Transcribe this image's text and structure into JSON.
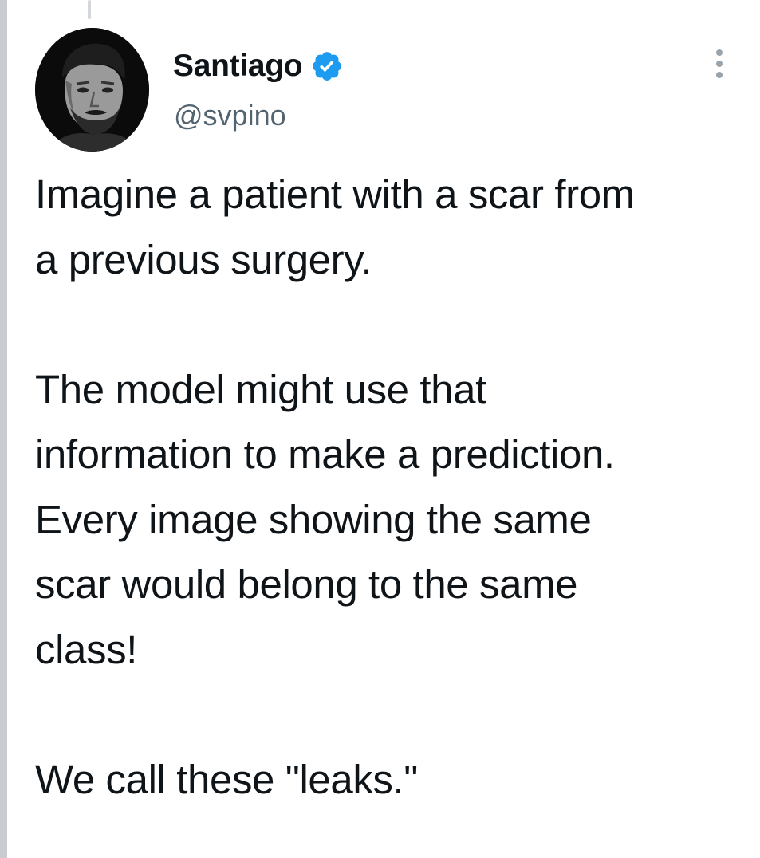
{
  "tweet": {
    "author": {
      "display_name": "Santiago",
      "handle": "@svpino",
      "verified": true,
      "avatar_icon": "profile-photo-man-bearded"
    },
    "menu_icon": "more-vertical-icon",
    "paragraphs": [
      [
        "Imagine a patient with a scar from",
        "a previous surgery."
      ],
      [
        "The model might use that",
        "information to make a prediction.",
        "Every image showing the same",
        "scar would belong to the same",
        "class!"
      ],
      [
        "We call these \"leaks.\""
      ]
    ]
  },
  "colors": {
    "verified_badge": "#1d9bf0",
    "text_primary": "#0f1419",
    "text_secondary": "#536471"
  }
}
